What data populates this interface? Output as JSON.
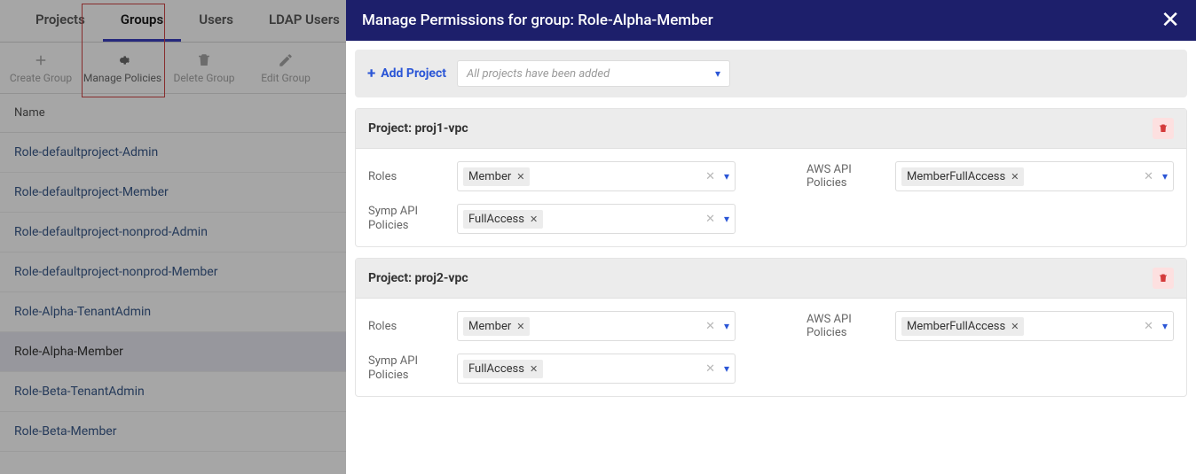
{
  "tabs": {
    "items": [
      "Projects",
      "Groups",
      "Users",
      "LDAP Users"
    ],
    "active_index": 1
  },
  "toolbar": {
    "create_group": "Create Group",
    "manage_policies": "Manage Policies",
    "delete_group": "Delete Group",
    "edit_group": "Edit Group"
  },
  "table": {
    "header_name": "Name",
    "rows": [
      "Role-defaultproject-Admin",
      "Role-defaultproject-Member",
      "Role-defaultproject-nonprod-Admin",
      "Role-defaultproject-nonprod-Member",
      "Role-Alpha-TenantAdmin",
      "Role-Alpha-Member",
      "Role-Beta-TenantAdmin",
      "Role-Beta-Member"
    ],
    "selected_index": 5
  },
  "modal": {
    "title": "Manage Permissions for group: Role-Alpha-Member",
    "add_project_label": "Add Project",
    "add_project_placeholder": "All projects have been added",
    "labels": {
      "roles": "Roles",
      "aws": "AWS API Policies",
      "symp": "Symp API Policies"
    },
    "projects": [
      {
        "title": "Project: proj1-vpc",
        "roles": [
          "Member"
        ],
        "aws": [
          "MemberFullAccess"
        ],
        "symp": [
          "FullAccess"
        ]
      },
      {
        "title": "Project: proj2-vpc",
        "roles": [
          "Member"
        ],
        "aws": [
          "MemberFullAccess"
        ],
        "symp": [
          "FullAccess"
        ]
      }
    ]
  }
}
